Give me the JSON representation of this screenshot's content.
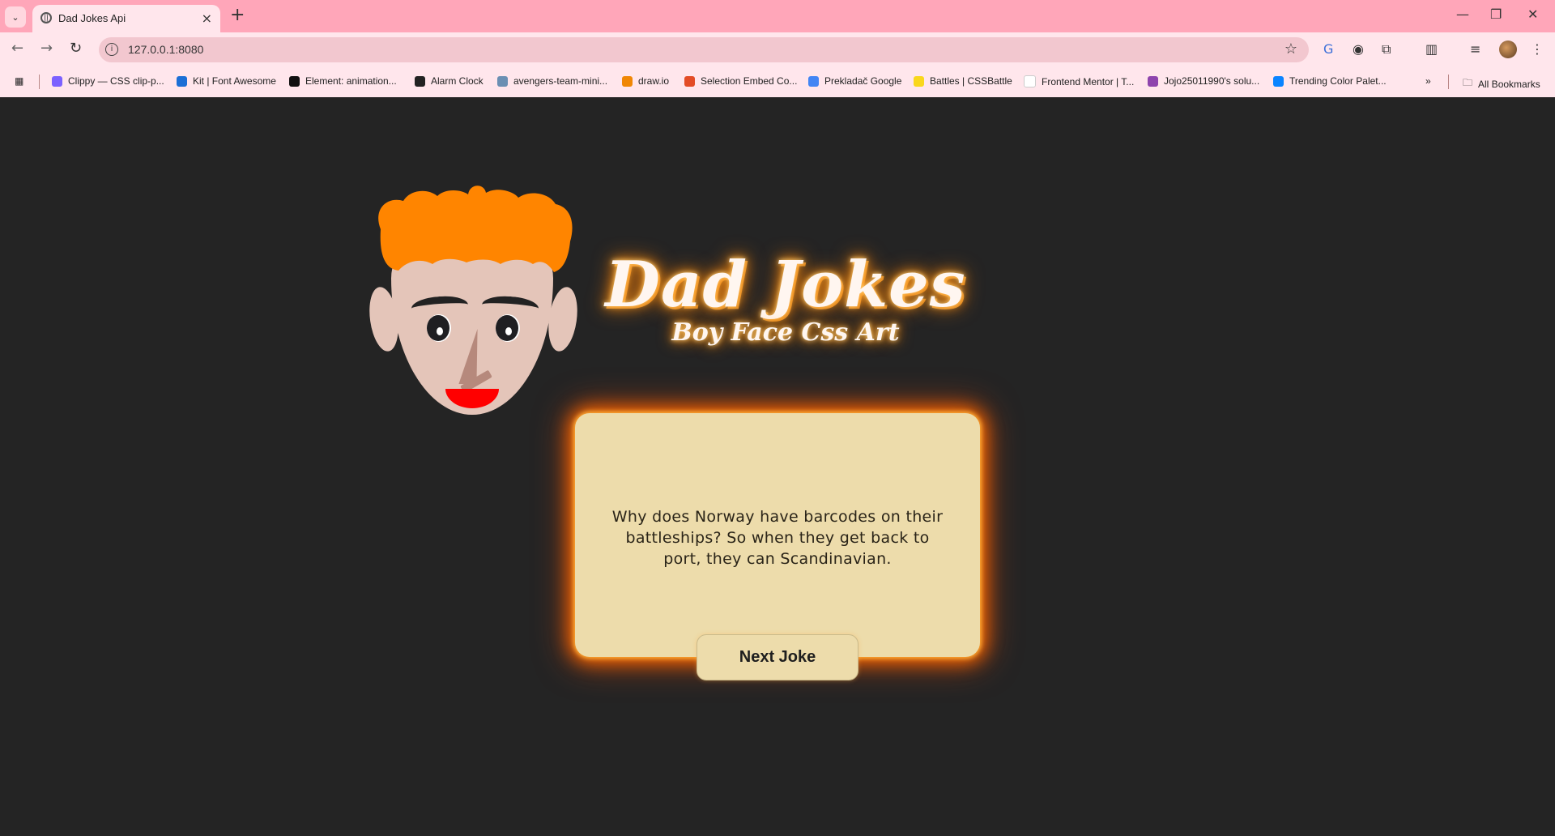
{
  "browser": {
    "tab_title": "Dad Jokes Api",
    "url": "127.0.0.1:8080",
    "new_tab_label": "+",
    "bookmarks": [
      {
        "label": "Clippy — CSS clip-p...",
        "color": "#7b61ff"
      },
      {
        "label": "Kit | Font Awesome",
        "color": "#1c6fd6"
      },
      {
        "label": "Element: animation...",
        "color": "#111111"
      },
      {
        "label": "Alarm Clock",
        "color": "#222222"
      },
      {
        "label": "avengers-team-mini...",
        "color": "#6b8fb3"
      },
      {
        "label": "draw.io",
        "color": "#f08705"
      },
      {
        "label": "Selection Embed Co...",
        "color": "#e34c26"
      },
      {
        "label": "Prekladač Google",
        "color": "#4285f4"
      },
      {
        "label": "Battles | CSSBattle",
        "color": "#f9d71c"
      },
      {
        "label": "Frontend Mentor | T...",
        "color": "#ffffff"
      },
      {
        "label": "Jojo25011990's solu...",
        "color": "#8e44ad"
      },
      {
        "label": "Trending Color Palet...",
        "color": "#0a84ff"
      }
    ],
    "all_bookmarks_label": "All Bookmarks"
  },
  "page": {
    "title": "Dad Jokes",
    "subtitle": "Boy Face Css Art",
    "joke": "Why does Norway have barcodes on their battleships? So when they get back to port, they can Scandinavian.",
    "next_button": "Next Joke",
    "colors": {
      "background": "#242424",
      "card": "#eddcab",
      "hair": "#ff8500",
      "skin": "#e4c5b9",
      "mouth": "#ff0000",
      "glow": "#ff6a00"
    }
  }
}
